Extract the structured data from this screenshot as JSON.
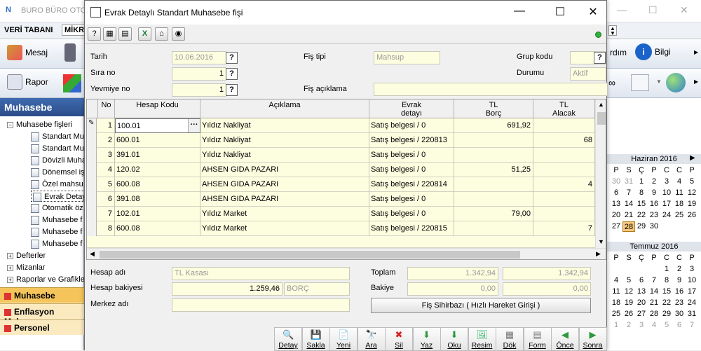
{
  "background_app": {
    "title": "BURO BÜRO OTO",
    "menu": [
      "VERİ TABANI",
      "MİKR"
    ],
    "toolbar_top": [
      "Mesaj",
      "rdım",
      "Bilgi"
    ],
    "toolbar_second": [
      "Rapor"
    ],
    "left_panel": {
      "header": "Muhasebe",
      "tree": [
        {
          "label": "Muhasebe fişleri",
          "level": 0,
          "expander": "−"
        },
        {
          "label": "Standart Mu",
          "level": 1
        },
        {
          "label": "Standart Mu",
          "level": 1
        },
        {
          "label": "Dövizli Muha",
          "level": 1
        },
        {
          "label": "Dönemsel iş",
          "level": 1
        },
        {
          "label": "Özel mahsu",
          "level": 1
        },
        {
          "label": "Evrak Detay",
          "level": 1,
          "selected": true
        },
        {
          "label": "Otomatik öz",
          "level": 1
        },
        {
          "label": "Muhasebe f",
          "level": 1
        },
        {
          "label": "Muhasebe f",
          "level": 1
        },
        {
          "label": "Muhasebe f",
          "level": 1
        },
        {
          "label": "Defterler",
          "level": 0,
          "expander": "+"
        },
        {
          "label": "Mizanlar",
          "level": 0,
          "expander": "+"
        },
        {
          "label": "Raporlar ve Grafikle",
          "level": 0,
          "expander": "+"
        }
      ],
      "bars": [
        {
          "label": "Muhasebe",
          "color": "#f5c45a"
        },
        {
          "label": "Enflasyon Muhas",
          "color": "#fbe9c0"
        },
        {
          "label": "Personel",
          "color": "#fbe9c0"
        }
      ]
    },
    "calendars": [
      {
        "month": "Haziran 2016",
        "weekdays": [
          "P",
          "S",
          "Ç",
          "P",
          "C",
          "C",
          "P"
        ],
        "days": [
          {
            "d": "30",
            "dim": true
          },
          {
            "d": "31",
            "dim": true
          },
          {
            "d": "1"
          },
          {
            "d": "2"
          },
          {
            "d": "3"
          },
          {
            "d": "4"
          },
          {
            "d": "5"
          },
          {
            "d": "6"
          },
          {
            "d": "7"
          },
          {
            "d": "8"
          },
          {
            "d": "9"
          },
          {
            "d": "10"
          },
          {
            "d": "11"
          },
          {
            "d": "12"
          },
          {
            "d": "13"
          },
          {
            "d": "14"
          },
          {
            "d": "15"
          },
          {
            "d": "16"
          },
          {
            "d": "17"
          },
          {
            "d": "18"
          },
          {
            "d": "19"
          },
          {
            "d": "20"
          },
          {
            "d": "21"
          },
          {
            "d": "22"
          },
          {
            "d": "23"
          },
          {
            "d": "24"
          },
          {
            "d": "25"
          },
          {
            "d": "26"
          },
          {
            "d": "27"
          },
          {
            "d": "28",
            "today": true
          },
          {
            "d": "29"
          },
          {
            "d": "30"
          }
        ]
      },
      {
        "month": "Temmuz 2016",
        "weekdays": [
          "P",
          "S",
          "Ç",
          "P",
          "C",
          "C",
          "P"
        ],
        "days": [
          {
            "d": ""
          },
          {
            "d": ""
          },
          {
            "d": ""
          },
          {
            "d": ""
          },
          {
            "d": "1"
          },
          {
            "d": "2"
          },
          {
            "d": "3"
          },
          {
            "d": "4"
          },
          {
            "d": "5"
          },
          {
            "d": "6"
          },
          {
            "d": "7"
          },
          {
            "d": "8"
          },
          {
            "d": "9"
          },
          {
            "d": "10"
          },
          {
            "d": "11"
          },
          {
            "d": "12"
          },
          {
            "d": "13"
          },
          {
            "d": "14"
          },
          {
            "d": "15"
          },
          {
            "d": "16"
          },
          {
            "d": "17"
          },
          {
            "d": "18"
          },
          {
            "d": "19"
          },
          {
            "d": "20"
          },
          {
            "d": "21"
          },
          {
            "d": "22"
          },
          {
            "d": "23"
          },
          {
            "d": "24"
          },
          {
            "d": "25"
          },
          {
            "d": "26"
          },
          {
            "d": "27"
          },
          {
            "d": "28"
          },
          {
            "d": "29"
          },
          {
            "d": "30"
          },
          {
            "d": "31"
          },
          {
            "d": "1",
            "dim": true
          },
          {
            "d": "2",
            "dim": true
          },
          {
            "d": "3",
            "dim": true
          },
          {
            "d": "4",
            "dim": true
          },
          {
            "d": "5",
            "dim": true
          },
          {
            "d": "6",
            "dim": true
          },
          {
            "d": "7",
            "dim": true
          }
        ]
      }
    ]
  },
  "dialog": {
    "title": "Evrak Detaylı Standart Muhasebe fişi",
    "toolbar_icons": [
      "help-icon",
      "calculator-icon",
      "print-icon",
      "excel-icon",
      "home-icon",
      "view-icon"
    ],
    "fields": {
      "tarih_label": "Tarih",
      "tarih_value": "10.06.2016",
      "sira_label": "Sıra no",
      "sira_value": "1",
      "yevmiye_label": "Yevmiye no",
      "yevmiye_value": "1",
      "fis_tipi_label": "Fiş tipi",
      "fis_tipi_value": "Mahsup",
      "fis_aciklama_label": "Fiş açıklama",
      "fis_aciklama_value": "",
      "grup_kodu_label": "Grup kodu",
      "grup_kodu_value": "",
      "durumu_label": "Durumu",
      "durumu_value": "Aktif",
      "q": "?"
    },
    "grid": {
      "headers": {
        "no": "No",
        "hesap_kodu": "Hesap Kodu",
        "aciklama": "Açıklama",
        "evrak_detayi_1": "Evrak",
        "evrak_detayi_2": "detayı",
        "borc_1": "TL",
        "borc_2": "Borç",
        "alacak_1": "TL",
        "alacak_2": "Alacak"
      },
      "rows": [
        {
          "no": "1",
          "hesap": "100.01",
          "aciklama": "Yıldız Nakliyat",
          "evrak": "Satış belgesi / 0",
          "borc": "691,92",
          "alacak": ""
        },
        {
          "no": "2",
          "hesap": "600.01",
          "aciklama": "Yıldız Nakliyat",
          "evrak": "Satış belgesi / 220813",
          "borc": "",
          "alacak": "68"
        },
        {
          "no": "3",
          "hesap": "391.01",
          "aciklama": "Yıldız Nakliyat",
          "evrak": "Satış belgesi / 0",
          "borc": "",
          "alacak": ""
        },
        {
          "no": "4",
          "hesap": "120.02",
          "aciklama": "AHSEN GIDA PAZARI",
          "evrak": "Satış belgesi / 0",
          "borc": "51,25",
          "alacak": ""
        },
        {
          "no": "5",
          "hesap": "600.08",
          "aciklama": "AHSEN GIDA PAZARI",
          "evrak": "Satış belgesi / 220814",
          "borc": "",
          "alacak": "4"
        },
        {
          "no": "6",
          "hesap": "391.08",
          "aciklama": "AHSEN GIDA PAZARI",
          "evrak": "Satış belgesi / 0",
          "borc": "",
          "alacak": ""
        },
        {
          "no": "7",
          "hesap": "102.01",
          "aciklama": "Yıldız Market",
          "evrak": "Satış belgesi / 0",
          "borc": "79,00",
          "alacak": ""
        },
        {
          "no": "8",
          "hesap": "600.08",
          "aciklama": "Yıldız Market",
          "evrak": "Satış belgesi / 220815",
          "borc": "",
          "alacak": "7"
        }
      ],
      "ellipsis": "···"
    },
    "summary": {
      "hesap_adi_label": "Hesap adı",
      "hesap_adi_value": "TL Kasası",
      "hesap_bakiyesi_label": "Hesap bakiyesi",
      "hesap_bakiyesi_value": "1.259,46",
      "hesap_bakiyesi_type": "BORÇ",
      "merkez_adi_label": "Merkez adı",
      "merkez_adi_value": "",
      "toplam_label": "Toplam",
      "toplam_borc": "1.342,94",
      "toplam_alacak": "1.342,94",
      "bakiye_label": "Bakiye",
      "bakiye_borc": "0,00",
      "bakiye_alacak": "0,00",
      "sihirbaz_label": "Fiş Sihirbazı ( Hızlı Hareket Girişi )"
    },
    "bottom_buttons": [
      {
        "label": "Detay",
        "icon": "🔍",
        "name": "detay-button"
      },
      {
        "label": "Sakla",
        "icon": "💾",
        "name": "sakla-button"
      },
      {
        "label": "Yeni",
        "icon": "📄",
        "name": "yeni-button"
      },
      {
        "label": "Ara",
        "icon": "🔭",
        "name": "ara-button"
      },
      {
        "label": "Sil",
        "icon": "✖",
        "name": "sil-button"
      },
      {
        "label": "Yaz",
        "icon": "⬇",
        "name": "yaz-button"
      },
      {
        "label": "Oku",
        "icon": "⬇",
        "name": "oku-button"
      },
      {
        "label": "Resim",
        "icon": "🖼",
        "name": "resim-button"
      },
      {
        "label": "Dök",
        "icon": "▦",
        "name": "dok-button"
      },
      {
        "label": "Form",
        "icon": "▤",
        "name": "form-button"
      },
      {
        "label": "Önce",
        "icon": "◀",
        "name": "once-button"
      },
      {
        "label": "Sonra",
        "icon": "▶",
        "name": "sonra-button"
      }
    ]
  }
}
